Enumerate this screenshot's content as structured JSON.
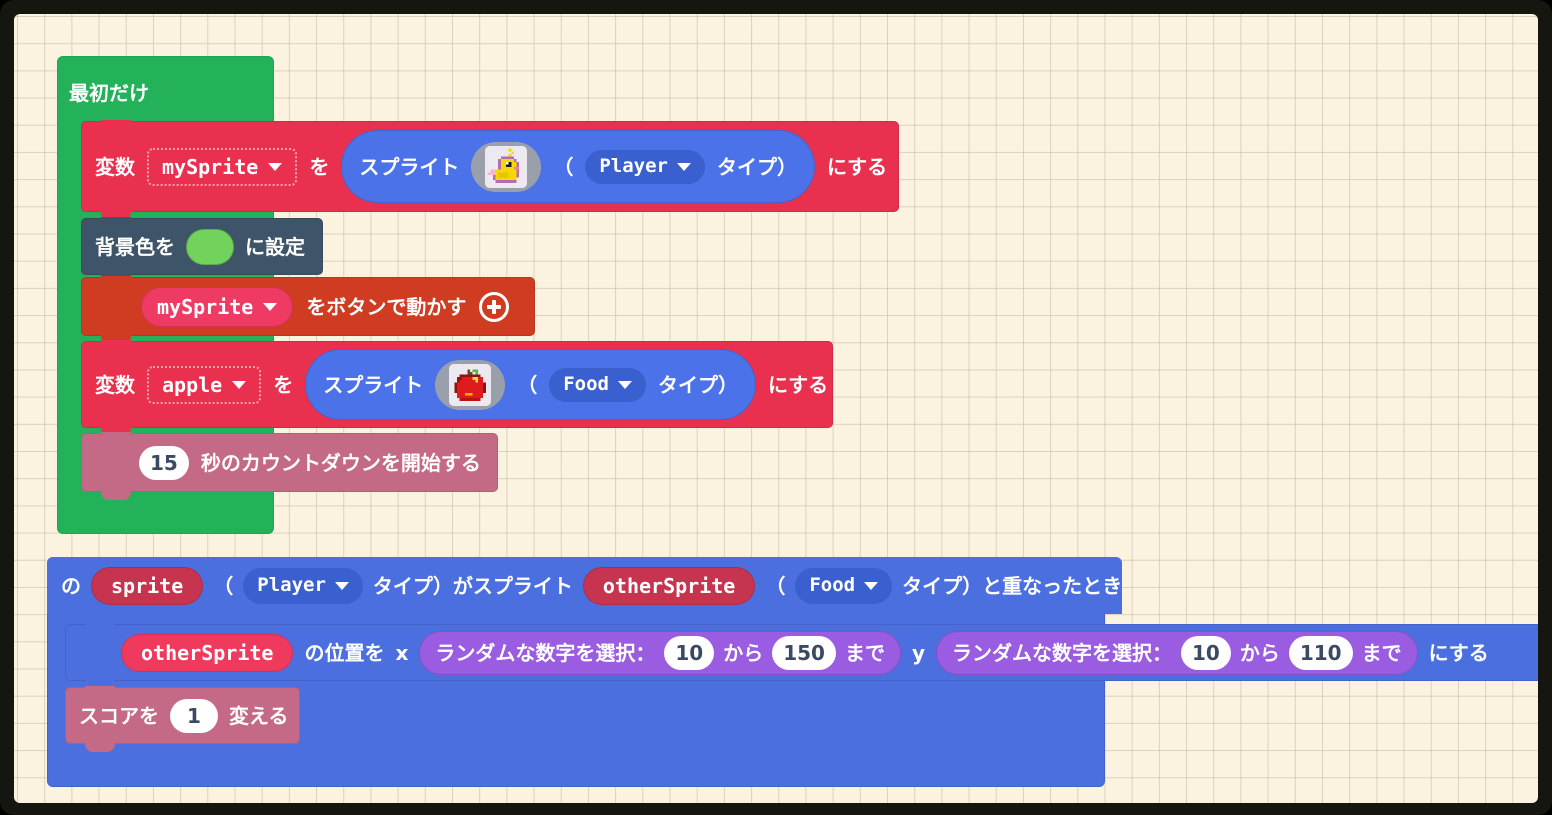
{
  "workspace": {
    "background_color": "#fcf2e0",
    "grid_color": "#b0a896",
    "frame_color": "#14160f"
  },
  "blocks": {
    "on_start": {
      "label": "最初だけ",
      "color": "#23b259",
      "children_count": 5
    },
    "set_mysprite": {
      "color": "#e9304f",
      "word_variable": "変数",
      "variable_name": "mySprite",
      "word_to": "を",
      "value_block": {
        "color": "#4b72e8",
        "label": "スプライト",
        "sprite_icon": "duck-sprite-icon",
        "paren_open": "（",
        "kind": "Player",
        "kind_suffix": "タイプ）"
      },
      "word_set": "にする"
    },
    "set_background_color": {
      "color": "#3d5469",
      "prefix": "背景色を",
      "swatch_color": "#72d35c",
      "suffix": "に設定"
    },
    "move_with_buttons": {
      "color": "#cf3c21",
      "variable_name": "mySprite",
      "label": "をボタンで動かす",
      "plus_icon": "plus-circle-icon"
    },
    "set_apple": {
      "color": "#e9304f",
      "word_variable": "変数",
      "variable_name": "apple",
      "word_to": "を",
      "value_block": {
        "color": "#4b72e8",
        "label": "スプライト",
        "sprite_icon": "apple-sprite-icon",
        "paren_open": "（",
        "kind": "Food",
        "kind_suffix": "タイプ）"
      },
      "word_set": "にする"
    },
    "start_countdown": {
      "color": "#c46a86",
      "seconds": "15",
      "label": "秒のカウントダウンを開始する"
    },
    "on_overlap": {
      "color": "#4c6fe0",
      "word_of": "の",
      "param_sprite": "sprite",
      "paren_open": "（",
      "kind_a": "Player",
      "middle": "タイプ）がスプライト",
      "param_other_sprite": "otherSprite",
      "paren_open_2": "（",
      "kind_b": "Food",
      "tail": "タイプ）と重なったとき"
    },
    "set_position": {
      "color": "#4c6fe0",
      "param_name": "otherSprite",
      "label_position": "の位置を",
      "axis_x": "x",
      "axis_y": "y",
      "word_set": "にする",
      "random_x": {
        "color": "#9a5ce0",
        "label": "ランダムな数字を選択：",
        "from_value": "10",
        "word_from": "から",
        "to_value": "150",
        "word_to": "まで"
      },
      "random_y": {
        "color": "#9a5ce0",
        "label": "ランダムな数字を選択：",
        "from_value": "10",
        "word_from": "から",
        "to_value": "110",
        "word_to": "まで"
      }
    },
    "change_score": {
      "color": "#c46a86",
      "prefix": "スコアを",
      "amount": "1",
      "suffix": "変える"
    }
  }
}
